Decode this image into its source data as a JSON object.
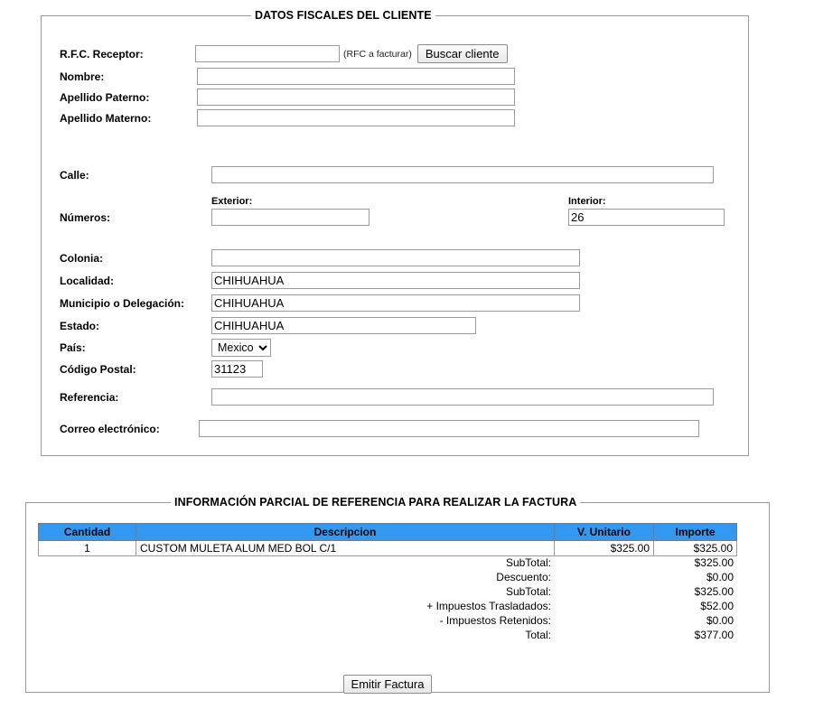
{
  "client_section": {
    "legend": "DATOS FISCALES DEL CLIENTE",
    "fields": {
      "rfc_label": "R.F.C. Receptor:",
      "rfc_value": "",
      "rfc_hint": "(RFC a facturar)",
      "search_button": "Buscar cliente",
      "nombre_label": "Nombre:",
      "nombre_value": "",
      "apellido_paterno_label": "Apellido Paterno:",
      "apellido_paterno_value": "",
      "apellido_materno_label": "Apellido Materno:",
      "apellido_materno_value": "",
      "calle_label": "Calle:",
      "calle_value": "",
      "numeros_label": "Números:",
      "exterior_label": "Exterior:",
      "exterior_value": "",
      "interior_label": "Interior:",
      "interior_value": "26",
      "colonia_label": "Colonia:",
      "colonia_value": "",
      "localidad_label": "Localidad:",
      "localidad_value": "CHIHUAHUA",
      "municipio_label": "Municipio o Delegación:",
      "municipio_value": "CHIHUAHUA",
      "estado_label": "Estado:",
      "estado_value": "CHIHUAHUA",
      "pais_label": "País:",
      "pais_value": "Mexico",
      "codigo_postal_label": "Código Postal:",
      "codigo_postal_value": "31123",
      "referencia_label": "Referencia:",
      "referencia_value": "",
      "correo_label": "Correo electrónico:",
      "correo_value": ""
    }
  },
  "invoice_section": {
    "legend": "INFORMACIÓN PARCIAL DE REFERENCIA PARA REALIZAR LA FACTURA",
    "columns": {
      "cantidad": "Cantidad",
      "descripcion": "Descripcion",
      "v_unitario": "V. Unitario",
      "importe": "Importe"
    },
    "rows": [
      {
        "cantidad": "1",
        "descripcion": "CUSTOM MULETA ALUM MED BOL C/1",
        "v_unitario": "$325.00",
        "importe": "$325.00"
      }
    ],
    "totals": [
      {
        "label": "SubTotal:",
        "value": "$325.00"
      },
      {
        "label": "Descuento:",
        "value": "$0.00"
      },
      {
        "label": "SubTotal:",
        "value": "$325.00"
      },
      {
        "label": "+ Impuestos Trasladados:",
        "value": "$52.00"
      },
      {
        "label": "- Impuestos Retenidos:",
        "value": "$0.00"
      },
      {
        "label": "Total:",
        "value": "$377.00"
      }
    ],
    "emit_button": "Emitir Factura"
  },
  "colors": {
    "table_header_bg": "#3399f0",
    "border": "#9b9b9b",
    "text": "#000000"
  }
}
